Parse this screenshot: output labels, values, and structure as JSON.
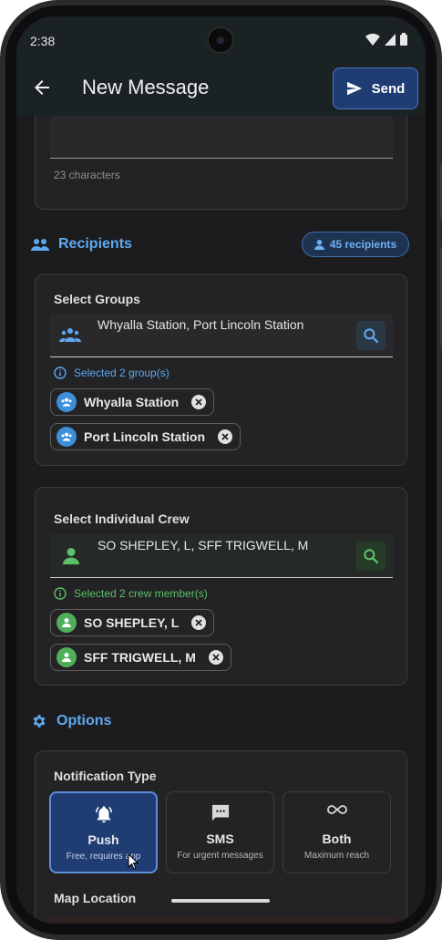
{
  "status_bar": {
    "time": "2:38"
  },
  "app_bar": {
    "title": "New Message",
    "send_label": "Send"
  },
  "message": {
    "char_count": "23 characters"
  },
  "recipients": {
    "title": "Recipients",
    "count_badge": "45 recipients",
    "groups": {
      "label": "Select Groups",
      "value": "Whyalla Station, Port Lincoln Station",
      "hint": "Selected 2 group(s)",
      "chips": [
        {
          "label": "Whyalla Station"
        },
        {
          "label": "Port Lincoln Station"
        }
      ]
    },
    "crew": {
      "label": "Select Individual Crew",
      "value": "SO SHEPLEY, L, SFF TRIGWELL, M",
      "hint": "Selected 2 crew member(s)",
      "chips": [
        {
          "label": "SO SHEPLEY, L"
        },
        {
          "label": "SFF TRIGWELL, M"
        }
      ]
    }
  },
  "options": {
    "title": "Options",
    "notification_type": {
      "label": "Notification Type",
      "selected": "Push",
      "choices": [
        {
          "name": "Push",
          "desc": "Free, requires app",
          "icon": "bell-ring-icon"
        },
        {
          "name": "SMS",
          "desc": "For urgent messages",
          "icon": "sms-icon"
        },
        {
          "name": "Both",
          "desc": "Maximum reach",
          "icon": "infinity-icon"
        }
      ]
    },
    "map_location": {
      "label": "Map Location"
    }
  },
  "colors": {
    "accent_blue": "#5fa8f0",
    "accent_green": "#5cc06a",
    "send_button": "#1f3d73",
    "background": "#1c1c1e"
  }
}
